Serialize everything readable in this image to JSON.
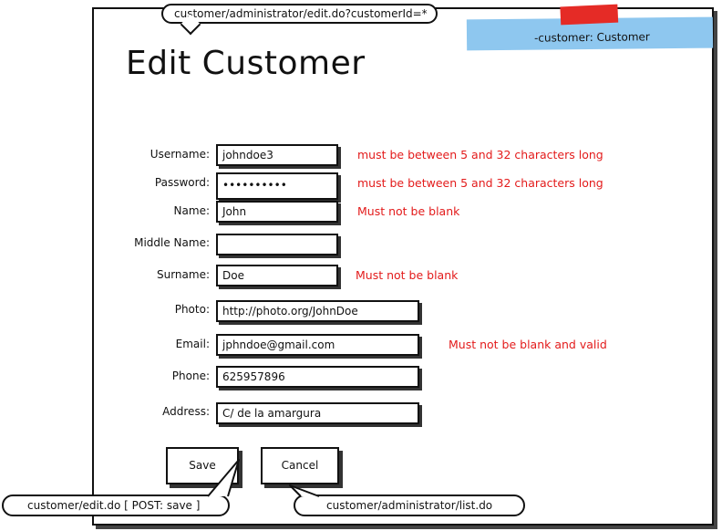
{
  "annotations": {
    "url": "customer/administrator/edit.do?customerId=*",
    "save_action": "customer/edit.do [ POST: save ]",
    "cancel_action": "customer/administrator/list.do"
  },
  "sticky_note": {
    "label": "-customer: Customer"
  },
  "page_title": "Edit Customer",
  "form": {
    "username": {
      "label": "Username:",
      "value": "johndoe3",
      "error": "must be between 5 and 32 characters long"
    },
    "password": {
      "label": "Password:",
      "value": "••••••••••",
      "error": "must be between 5 and 32 characters long"
    },
    "name": {
      "label": "Name:",
      "value": "John",
      "error": "Must not be blank"
    },
    "middle_name": {
      "label": "Middle Name:",
      "value": ""
    },
    "surname": {
      "label": "Surname:",
      "value": "Doe",
      "error": "Must not be blank"
    },
    "photo": {
      "label": "Photo:",
      "value": "http://photo.org/JohnDoe"
    },
    "email": {
      "label": "Email:",
      "value": "jphndoe@gmail.com",
      "error": "Must not be blank and valid"
    },
    "phone": {
      "label": "Phone:",
      "value": "625957896"
    },
    "address": {
      "label": "Address:",
      "value": "C/ de la amargura"
    }
  },
  "buttons": {
    "save": "Save",
    "cancel": "Cancel"
  },
  "colors": {
    "error": "#e31b1b",
    "sticky": "#8ec7ef",
    "tape": "#e52b26"
  }
}
